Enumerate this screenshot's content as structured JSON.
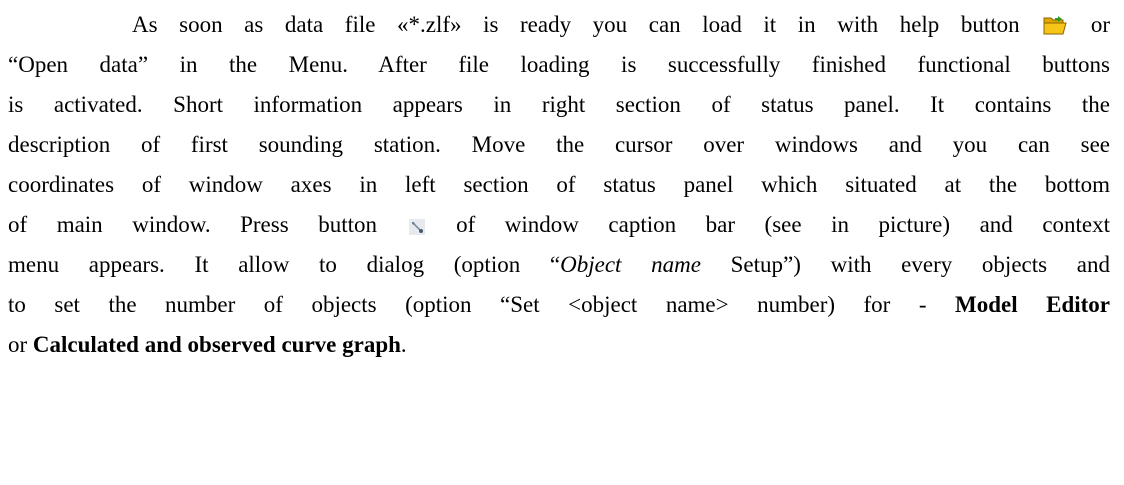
{
  "document": {
    "line1": {
      "before_icon": "As soon as data file «*.zlf» is ready you can load it in with help button",
      "after_icon": "or"
    },
    "line2": "“Open data” in the Menu. After file loading is successfully finished functional buttons",
    "line3": "is activated. Short information appears in right section of status panel. It contains the",
    "line4": "description of first sounding station.   Move the cursor over windows and you can see",
    "line5": "coordinates of window axes in left section of status panel which situated at the bottom",
    "line6": "of main window.  Press button",
    "line6_after_icon": "of window caption bar  (see in picture) and context",
    "line7": "menu appears. It allow to dialog (option “",
    "line7_italic": "Object name",
    "line7_after": " Setup”) with every objects and",
    "line8": "to set the number of objects (option “Set <object name> number) for - ",
    "line8_bold": "Model Editor",
    "line9_start": "or ",
    "line9_bold": "Calculated and observed curve graph",
    "line9_end": "."
  },
  "icons": {
    "open_folder": "open-folder-icon",
    "wrench": "wrench-icon"
  },
  "colors": {
    "text": "#000000",
    "background": "#ffffff",
    "folder": "#f5c518",
    "folder_dark": "#b8860b",
    "wrench": "#6e7f96"
  }
}
